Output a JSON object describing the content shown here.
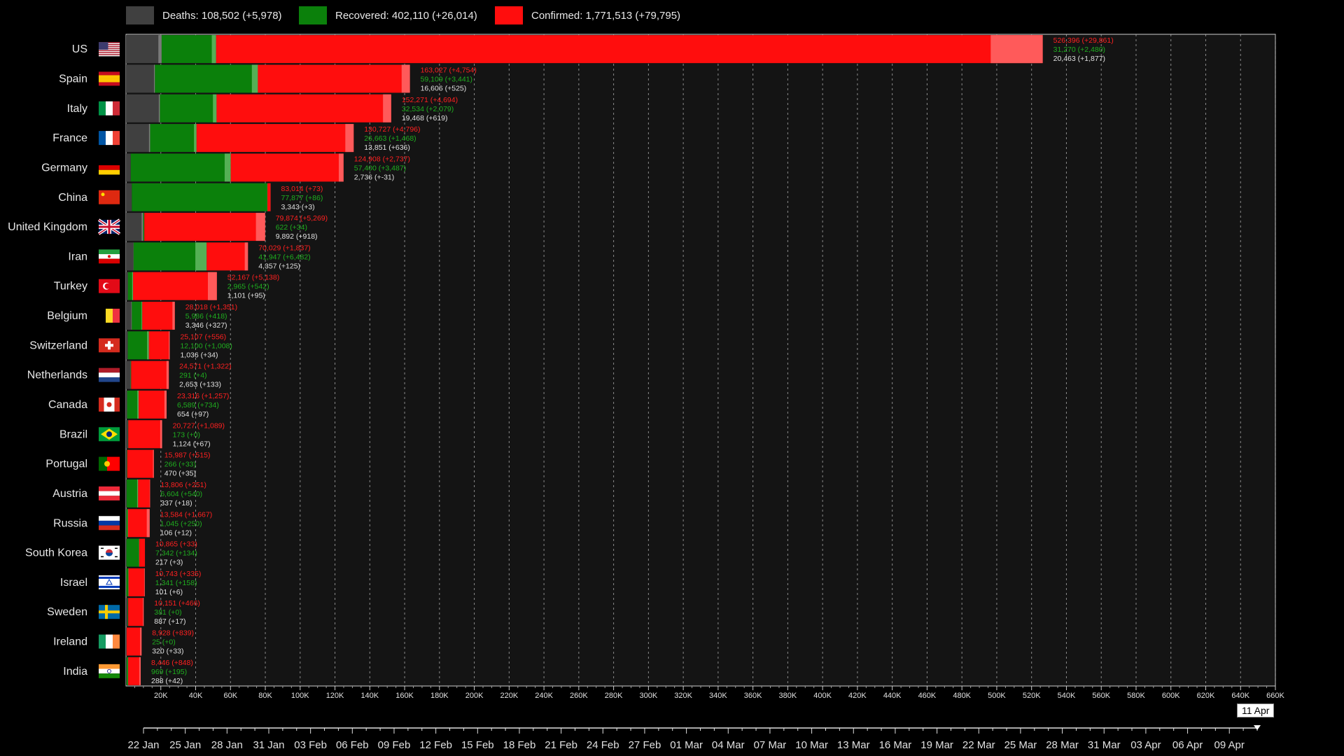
{
  "legend": {
    "deaths_label": "Deaths: 108,502 (+5,978)",
    "recovered_label": "Recovered: 402,110 (+26,014)",
    "confirmed_label": "Confirmed: 1,771,513 (+79,795)"
  },
  "colors": {
    "deaths": "#404040",
    "recovered": "#0b800b",
    "confirmed": "#ff0d0d",
    "deaths_inc": "#7a7a7a",
    "recovered_inc": "#55b055",
    "confirmed_inc": "#ff5a5a"
  },
  "chart_data": {
    "type": "bar",
    "orientation": "horizontal-stacked",
    "categories": [
      "US",
      "Spain",
      "Italy",
      "France",
      "Germany",
      "China",
      "United Kingdom",
      "Iran",
      "Turkey",
      "Belgium",
      "Switzerland",
      "Netherlands",
      "Canada",
      "Brazil",
      "Portugal",
      "Austria",
      "Russia",
      "South Korea",
      "Israel",
      "Sweden",
      "Ireland",
      "India"
    ],
    "flags": [
      "us",
      "es",
      "it",
      "fr",
      "de",
      "cn",
      "gb",
      "ir",
      "tr",
      "be",
      "ch",
      "nl",
      "ca",
      "br",
      "pt",
      "at",
      "ru",
      "kr",
      "il",
      "se",
      "ie",
      "in"
    ],
    "series": [
      {
        "name": "Deaths",
        "values": [
          20463,
          16606,
          19468,
          13851,
          2736,
          3343,
          9892,
          4357,
          1101,
          3346,
          1036,
          2653,
          654,
          1124,
          470,
          337,
          106,
          217,
          101,
          887,
          320,
          288
        ],
        "increments": [
          1877,
          525,
          619,
          636,
          -31,
          3,
          918,
          125,
          95,
          327,
          34,
          133,
          97,
          67,
          35,
          18,
          12,
          3,
          6,
          17,
          33,
          42
        ],
        "labels": [
          "20,463 (+1,877)",
          "16,606 (+525)",
          "19,468 (+619)",
          "13,851 (+636)",
          "2,736 (+-31)",
          "3,343 (+3)",
          "9,892 (+918)",
          "4,357 (+125)",
          "1,101 (+95)",
          "3,346 (+327)",
          "1,036 (+34)",
          "2,653 (+133)",
          "654 (+97)",
          "1,124 (+67)",
          "470 (+35)",
          "337 (+18)",
          "106 (+12)",
          "217 (+3)",
          "101 (+6)",
          "887 (+17)",
          "320 (+33)",
          "288 (+42)"
        ]
      },
      {
        "name": "Recovered",
        "values": [
          31270,
          59109,
          32534,
          26663,
          57400,
          77877,
          622,
          41947,
          2965,
          5986,
          12100,
          291,
          6589,
          173,
          266,
          6604,
          1045,
          7342,
          1341,
          381,
          25,
          969
        ],
        "increments": [
          2480,
          3441,
          2079,
          1468,
          3487,
          86,
          34,
          6482,
          542,
          418,
          1008,
          4,
          734,
          0,
          33,
          540,
          250,
          134,
          158,
          0,
          0,
          195
        ],
        "labels": [
          "31,270 (+2,480)",
          "59,109 (+3,441)",
          "32,534 (+2,079)",
          "26,663 (+1,468)",
          "57,400 (+3,487)",
          "77,877 (+86)",
          "622 (+34)",
          "41,947 (+6,482)",
          "2,965 (+542)",
          "5,986 (+418)",
          "12,100 (+1,008)",
          "291 (+4)",
          "6,589 (+734)",
          "173 (+0)",
          "266 (+33)",
          "6,604 (+540)",
          "1,045 (+250)",
          "7,342 (+134)",
          "1,341 (+158)",
          "381 (+0)",
          "25 (+0)",
          "969 (+195)"
        ]
      },
      {
        "name": "Confirmed",
        "values": [
          526396,
          163027,
          152271,
          130727,
          124908,
          83014,
          79874,
          70029,
          52167,
          28018,
          25107,
          24571,
          23316,
          20727,
          15987,
          13806,
          13584,
          10865,
          10743,
          10151,
          8928,
          8446
        ],
        "increments": [
          29861,
          4754,
          4694,
          4796,
          2737,
          73,
          5269,
          1837,
          5138,
          1351,
          556,
          1322,
          1257,
          1089,
          515,
          251,
          1667,
          33,
          335,
          466,
          839,
          848
        ],
        "labels": [
          "526,396 (+29,861)",
          "163,027 (+4,754)",
          "152,271 (+4,694)",
          "130,727 (+4,796)",
          "124,908 (+2,737)",
          "83,014 (+73)",
          "79,874 (+5,269)",
          "70,029 (+1,837)",
          "52,167 (+5,138)",
          "28,018 (+1,351)",
          "25,107 (+556)",
          "24,571 (+1,322)",
          "23,316 (+1,257)",
          "20,727 (+1,089)",
          "15,987 (+515)",
          "13,806 (+251)",
          "13,584 (+1,667)",
          "10,865 (+33)",
          "10,743 (+335)",
          "10,151 (+466)",
          "8,928 (+839)",
          "8,446 (+848)"
        ]
      }
    ],
    "xlim": [
      0,
      660000
    ],
    "xticks": [
      "20K",
      "40K",
      "60K",
      "80K",
      "100K",
      "120K",
      "140K",
      "160K",
      "180K",
      "200K",
      "220K",
      "240K",
      "260K",
      "280K",
      "300K",
      "320K",
      "340K",
      "360K",
      "380K",
      "400K",
      "420K",
      "440K",
      "460K",
      "480K",
      "500K",
      "520K",
      "540K",
      "560K",
      "580K",
      "600K",
      "620K",
      "640K",
      "660K"
    ],
    "grid": true,
    "timeline": {
      "dates": [
        "22 Jan",
        "25 Jan",
        "28 Jan",
        "31 Jan",
        "03 Feb",
        "06 Feb",
        "09 Feb",
        "12 Feb",
        "15 Feb",
        "18 Feb",
        "21 Feb",
        "24 Feb",
        "27 Feb",
        "01 Mar",
        "04 Mar",
        "07 Mar",
        "10 Mar",
        "13 Mar",
        "16 Mar",
        "19 Mar",
        "22 Mar",
        "25 Mar",
        "28 Mar",
        "31 Mar",
        "03 Apr",
        "06 Apr",
        "09 Apr"
      ],
      "current": "11 Apr"
    }
  }
}
